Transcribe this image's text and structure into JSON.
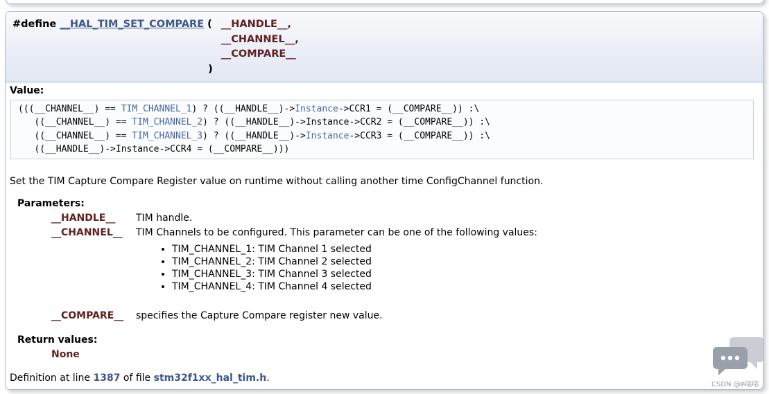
{
  "prototype": {
    "define_keyword": "#define",
    "macro_name": "__HAL_TIM_SET_COMPARE",
    "open_paren": "(",
    "params": [
      "__HANDLE__,",
      "__CHANNEL__,",
      "__COMPARE__"
    ],
    "close_paren": ")"
  },
  "value_section": {
    "label": "Value:",
    "code_lines": [
      {
        "pre": "(((__CHANNEL__) == ",
        "link": "TIM_CHANNEL_1",
        "mid": ") ? ((__HANDLE__)->",
        "link2": "Instance",
        "post": "->CCR1 = (__COMPARE__)) :\\"
      },
      {
        "pre": "   ((__CHANNEL__) == ",
        "link": "TIM_CHANNEL_2",
        "mid": ") ? ((__HANDLE__)->",
        "link2": "",
        "post": "Instance->CCR2 = (__COMPARE__)) :\\"
      },
      {
        "pre": "   ((__CHANNEL__) == ",
        "link": "TIM_CHANNEL_3",
        "mid": ") ? ((__HANDLE__)->",
        "link2": "Instance",
        "post": "->CCR3 = (__COMPARE__)) :\\"
      },
      {
        "pre": "   ((__HANDLE__)->Instance->CCR4 = (__COMPARE__)))",
        "link": "",
        "mid": "",
        "link2": "",
        "post": ""
      }
    ]
  },
  "description": "Set the TIM Capture Compare Register value on runtime without calling another time ConfigChannel function.",
  "parameters": {
    "label": "Parameters:",
    "items": [
      {
        "name": "__HANDLE__",
        "desc": "TIM handle."
      },
      {
        "name": "__CHANNEL__",
        "desc": "TIM Channels to be configured. This parameter can be one of the following values:"
      },
      {
        "name": "__COMPARE__",
        "desc": "specifies the Capture Compare register new value."
      }
    ],
    "channel_values": [
      "TIM_CHANNEL_1: TIM Channel 1 selected",
      "TIM_CHANNEL_2: TIM Channel 2 selected",
      "TIM_CHANNEL_3: TIM Channel 3 selected",
      "TIM_CHANNEL_4: TIM Channel 4 selected"
    ]
  },
  "return_values": {
    "label": "Return values:",
    "value": "None"
  },
  "definition": {
    "prefix": "Definition at line",
    "line": "1387",
    "middle": "of file",
    "file": "stm32f1xx_hal_tim.h",
    "suffix": "."
  },
  "watermark": "CSDN @ฅ咕咕",
  "colors": {
    "link": "#3d578c",
    "param": "#602020",
    "border": "#a8b8d9"
  }
}
